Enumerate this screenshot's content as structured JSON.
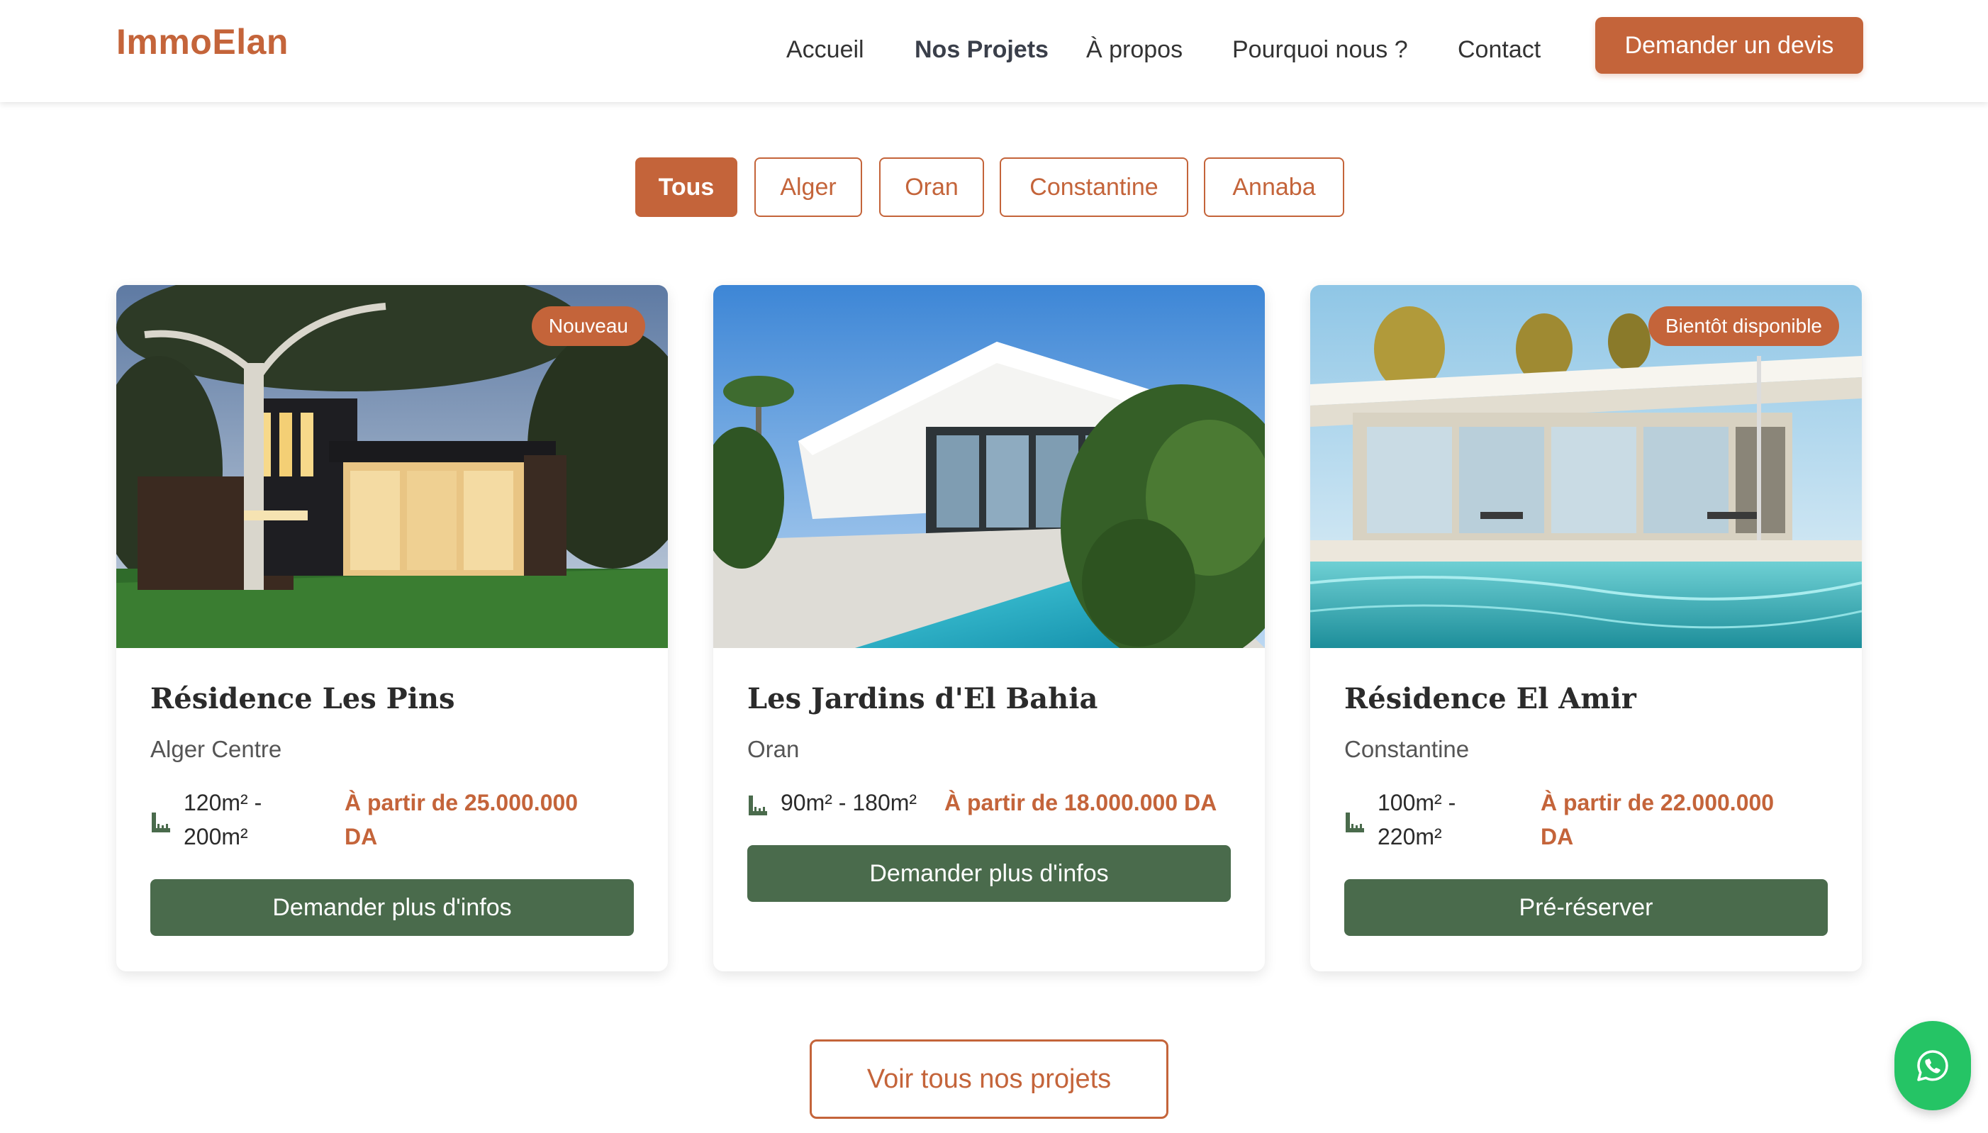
{
  "brand": {
    "logo": "ImmoElan",
    "accent": "#c4643a",
    "secondary": "#4a6b4c",
    "whatsapp_green": "#25c465"
  },
  "nav": {
    "items": [
      "Accueil",
      "Nos Projets",
      "À propos",
      "Pourquoi nous ?",
      "Contact"
    ],
    "active": "Nos Projets",
    "cta": "Demander un devis"
  },
  "filters": {
    "items": [
      "Tous",
      "Alger",
      "Oran",
      "Constantine",
      "Annaba"
    ],
    "active": "Tous"
  },
  "projects": [
    {
      "badge": "Nouveau",
      "title": "Résidence Les Pins",
      "location": "Alger Centre",
      "size_line1": "120m² -",
      "size_line2": "200m²",
      "price_line1": "À partir de 25.000.000",
      "price_line2": "DA",
      "button": "Demander plus d'infos"
    },
    {
      "badge": "",
      "title": "Les Jardins d'El Bahia",
      "location": "Oran",
      "size_line1": "90m² - 180m²",
      "size_line2": "",
      "price_line1": "À partir de 18.000.000 DA",
      "price_line2": "",
      "button": "Demander plus d'infos"
    },
    {
      "badge": "Bientôt disponible",
      "title": "Résidence El Amir",
      "location": "Constantine",
      "size_line1": "100m² -",
      "size_line2": "220m²",
      "price_line1": "À partir de 22.000.000",
      "price_line2": "DA",
      "button": "Pré-réserver"
    }
  ],
  "all_projects_button": "Voir tous nos projets",
  "icons": {
    "size": "ruler-icon",
    "chat": "whatsapp-icon"
  }
}
